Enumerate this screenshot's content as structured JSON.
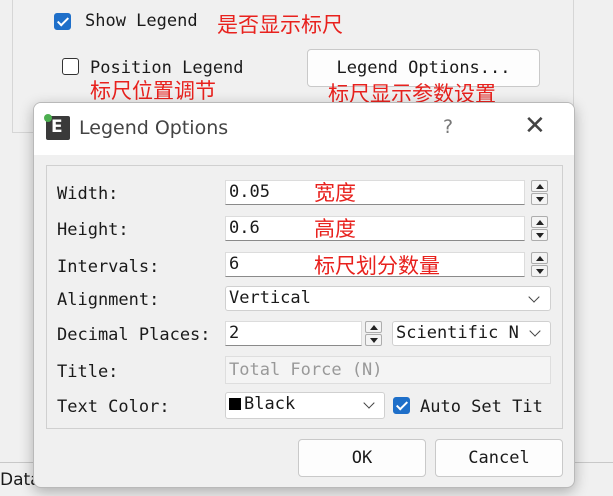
{
  "background": {
    "show_legend_label": "Show Legend",
    "show_legend_checked": true,
    "show_legend_note": "是否显示标尺",
    "position_legend_label": "Position Legend",
    "position_legend_checked": false,
    "position_legend_note": "标尺位置调节",
    "legend_options_button": "Legend Options...",
    "legend_options_note": "标尺显示参数设置",
    "data_label": "Data"
  },
  "dialog": {
    "title": "Legend Options",
    "help_glyph": "?",
    "close_glyph": "✕",
    "app_icon": "app-logo-icon",
    "fields": {
      "width": {
        "label": "Width:",
        "value": "0.05",
        "note": "宽度"
      },
      "height": {
        "label": "Height:",
        "value": "0.6",
        "note": "高度"
      },
      "intervals": {
        "label": "Intervals:",
        "value": "6",
        "note": "标尺划分数量"
      },
      "alignment": {
        "label": "Alignment:",
        "value": "Vertical"
      },
      "decimal_places": {
        "label": "Decimal Places:",
        "value": "2",
        "format": "Scientific N"
      },
      "title": {
        "label": "Title:",
        "placeholder": "Total Force (N)"
      },
      "text_color": {
        "label": "Text Color:",
        "value": "Black",
        "auto_set_label": "Auto Set Tit",
        "auto_set_checked": true
      }
    },
    "ok_label": "OK",
    "cancel_label": "Cancel"
  },
  "colors": {
    "annotation": "#e8211d",
    "checkbox_accent": "#1e6fc9"
  }
}
